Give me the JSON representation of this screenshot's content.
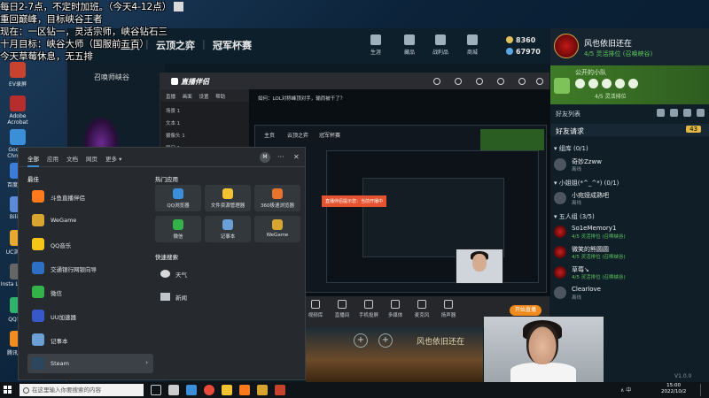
{
  "overlay": {
    "line1": "每日2-7点，不定时加班。（今天4-12点）",
    "line2": "重回巅峰，目标峡谷王者",
    "line3": "现在：一区钻一，灵活宗师，峡谷钻石三",
    "line4": "十月目标：峡谷大师（国服前五百）",
    "line5": "今天草莓休息，无五排"
  },
  "desktop_icons": [
    {
      "label": "EV录屏",
      "color": "#c8432d"
    },
    {
      "label": "Adobe\nAcrobat",
      "color": "#b52d2d"
    },
    {
      "label": "Google\nChrome",
      "color": "#3b8fd9"
    },
    {
      "label": "百度网盘",
      "color": "#3b7dd8"
    },
    {
      "label": "BiliBili",
      "color": "#5c8ad8"
    },
    {
      "label": "UC浏览器",
      "color": "#e8a930"
    },
    {
      "label": "Insta\nLeague",
      "color": "#666"
    },
    {
      "label": "QQ音乐",
      "color": "#2fb36c"
    },
    {
      "label": "腾讯视频",
      "color": "#f28c1c"
    }
  ],
  "wegame": {
    "game_title": "召唤师峡谷",
    "nav": [
      "主页",
      "|",
      "云顶之弈",
      "|",
      "冠军杯赛"
    ],
    "top_icons": [
      {
        "label": "生涯"
      },
      {
        "label": "藏品"
      },
      {
        "label": "战利品"
      },
      {
        "label": "商城"
      }
    ],
    "currency_1": "8360",
    "currency_2": "67970"
  },
  "profile": {
    "nickname": "风也依旧还在",
    "status": "4/5 灵活排位 (召唤峡谷)",
    "level": "102"
  },
  "team": {
    "title": "公开的小队",
    "subtitle": "4/5 灵活排位"
  },
  "friends": {
    "header": "好友列表",
    "title": "好友请求",
    "count": "43",
    "groups": [
      {
        "name": "▾ 组库 (0/1)"
      },
      {
        "name": "▾ 小姐姐(*^_^*) (0/1)"
      },
      {
        "name": "▾ 五人组 (3/5)"
      }
    ],
    "items": [
      {
        "name": "奇妙Zzww",
        "status": "离线",
        "online": false
      },
      {
        "name": "小宛娅成熟吧",
        "status": "离线",
        "online": false
      },
      {
        "name": "So1eMemory1",
        "status": "4/5 灵活排位 (召唤峡谷)",
        "online": true
      },
      {
        "name": "微笑的熊圆圆",
        "status": "4/5 灵活排位 (召唤峡谷)",
        "online": true
      },
      {
        "name": "草莓↘",
        "status": "4/5 灵活排位 (召唤峡谷)",
        "online": true
      },
      {
        "name": "Clearlove",
        "status": "离线",
        "online": false
      }
    ],
    "footer": "V1.0.0"
  },
  "streamer": {
    "logo": "直播伴侣",
    "menu": [
      "直播",
      "画面",
      "设置",
      "帮助"
    ],
    "scenes": [
      "场景 1",
      "文本 1",
      "摄像头 1",
      "窗口 1"
    ],
    "tools": [
      {
        "label": "视频库"
      },
      {
        "label": "直播间"
      },
      {
        "label": "手机投屏"
      },
      {
        "label": "多媒体"
      },
      {
        "label": "麦克风"
      },
      {
        "label": "扬声器"
      }
    ],
    "live_button": "开始直播",
    "tip": "直播伴侣提示您：当前开播中",
    "inner_header": "如何：LOL对称峰顶对手，输而被干了？",
    "inner_nav": [
      "主页",
      "云顶之弈",
      "冠军杯赛"
    ]
  },
  "startmenu": {
    "tabs": [
      "全部",
      "应用",
      "文档",
      "网页",
      "更多 ▾"
    ],
    "avatar": "M",
    "more": "···",
    "close": "✕",
    "best_match": "最佳",
    "apps": [
      {
        "label": "斗鱼直播伴侣",
        "color": "#ff7a1c"
      },
      {
        "label": "WeGame",
        "color": "#d8a531"
      },
      {
        "label": "QQ音乐",
        "color": "#f5c518"
      },
      {
        "label": "交通银行网银向导",
        "color": "#2c6fc4"
      },
      {
        "label": "微信",
        "color": "#34b24a"
      },
      {
        "label": "UU加速器",
        "color": "#3559c8"
      },
      {
        "label": "记事本",
        "color": "#6aa0d6"
      },
      {
        "label": "Steam",
        "color": "#2a475e"
      }
    ],
    "hot_title": "热门应用",
    "hot_apps": [
      {
        "label": "QQ浏览器",
        "color": "#3b8fd9"
      },
      {
        "label": "文件资源管理器",
        "color": "#f2c230"
      },
      {
        "label": "360极速浏览器",
        "color": "#e8732a"
      },
      {
        "label": "微信",
        "color": "#34b24a"
      },
      {
        "label": "记事本",
        "color": "#6aa0d6"
      },
      {
        "label": "WeGame",
        "color": "#d8a531"
      }
    ],
    "quick_title": "快速搜索",
    "quick": [
      {
        "label": "天气"
      },
      {
        "label": "新闻"
      }
    ]
  },
  "bottom_ui": {
    "name": "风也依旧还在"
  },
  "taskbar": {
    "search_placeholder": "在这里输入你要搜索的内容",
    "time": "15:00",
    "date": "2022/10/2",
    "tray": "∧ 中"
  }
}
